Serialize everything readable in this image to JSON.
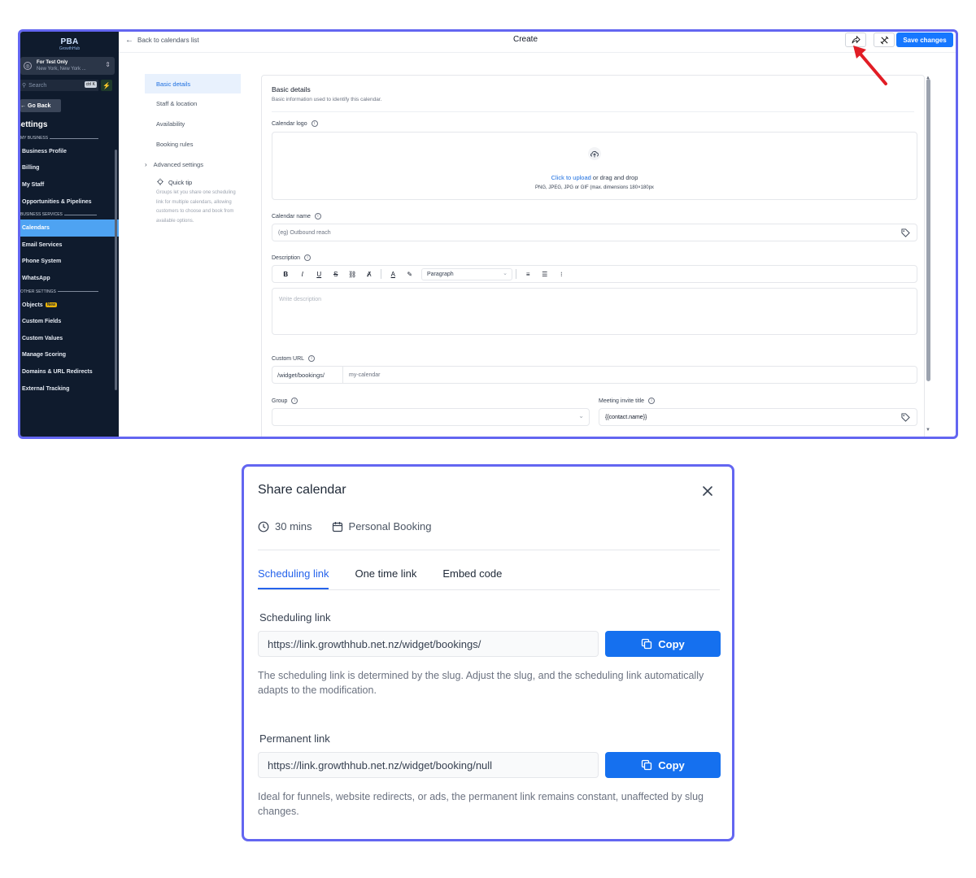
{
  "app": {
    "logo": "PBA",
    "logo_sub": "GrowthHub",
    "account_name": "For Test Only",
    "account_location": "New York, New York ...",
    "search_placeholder": "Search",
    "search_shortcut": "ctrl K",
    "go_back": "Go Back",
    "settings_title": "Settings",
    "sections": {
      "my_business": "MY BUSINESS",
      "business_services": "BUSINESS SERVICES",
      "other_settings": "OTHER SETTINGS"
    },
    "nav": {
      "business_profile": "Business Profile",
      "billing": "Billing",
      "my_staff": "My Staff",
      "opportunities": "Opportunities & Pipelines",
      "calendars": "Calendars",
      "email_services": "Email Services",
      "phone_system": "Phone System",
      "whatsapp": "WhatsApp",
      "objects": "Objects",
      "objects_badge": "New",
      "custom_fields": "Custom Fields",
      "custom_values": "Custom Values",
      "manage_scoring": "Manage Scoring",
      "domains": "Domains & URL Redirects",
      "external_tracking": "External Tracking"
    },
    "colors": {
      "sidebar": "#0f1b2d",
      "active": "#4ea3f2",
      "primary": "#1677ff",
      "frame": "#6366f1"
    }
  },
  "editor": {
    "back_link": "Back to calendars list",
    "title": "Create",
    "save_button": "Save changes",
    "side_nav": {
      "basic_details": "Basic details",
      "staff_location": "Staff & location",
      "availability": "Availability",
      "booking_rules": "Booking rules",
      "advanced_settings": "Advanced settings"
    },
    "quick_tip_title": "Quick tip",
    "quick_tip_text": "Groups let you share one scheduling link for multiple calendars, allowing customers to choose and book from available options.",
    "form": {
      "section_title": "Basic details",
      "section_subtitle": "Basic information used to identify this calendar.",
      "logo_label": "Calendar logo",
      "upload_link": "Click to upload",
      "upload_text": " or drag and drop",
      "upload_hint": "PNG, JPEG, JPG or GIF (max. dimensions 180×180px",
      "name_label": "Calendar name",
      "name_placeholder": "(eg) Outbound reach",
      "description_label": "Description",
      "paragraph_select": "Paragraph",
      "description_placeholder": "Write description",
      "custom_url_label": "Custom URL",
      "url_prefix": "/widget/bookings/",
      "url_slug": "my-calendar",
      "group_label": "Group",
      "invite_title_label": "Meeting invite title",
      "invite_title_value": "{{contact.name}}"
    }
  },
  "share_modal": {
    "title": "Share calendar",
    "duration": "30 mins",
    "booking_type": "Personal Booking",
    "tabs": [
      "Scheduling link",
      "One time link",
      "Embed code"
    ],
    "scheduling_label": "Scheduling link",
    "scheduling_url": "https://link.growthhub.net.nz/widget/bookings/",
    "copy_label": "Copy",
    "scheduling_help": "The scheduling link is determined by the slug. Adjust the slug, and the scheduling link automatically adapts to the modification.",
    "permanent_label": "Permanent link",
    "permanent_url": "https://link.growthhub.net.nz/widget/booking/null",
    "permanent_help": "Ideal for funnels, website redirects, or ads, the permanent link remains constant, unaffected by slug changes.",
    "accent": "#2563eb"
  }
}
